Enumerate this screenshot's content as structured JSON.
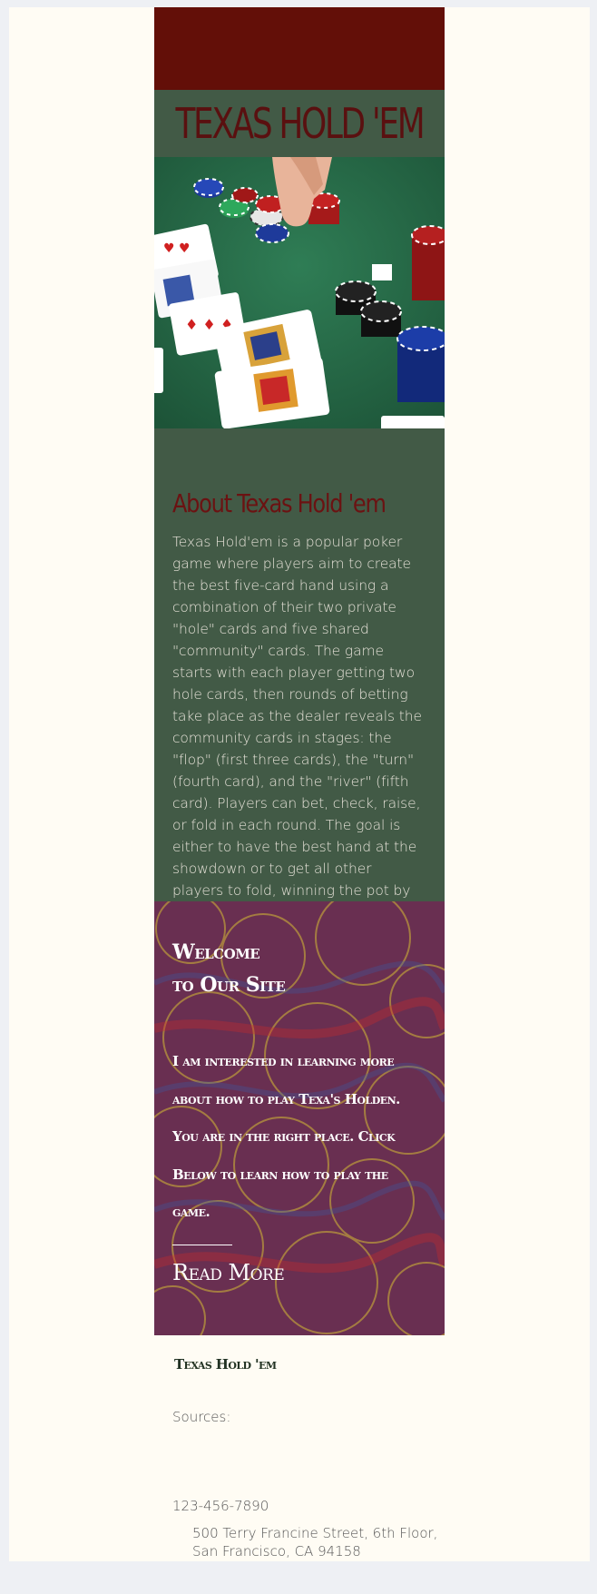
{
  "header": {
    "site_title": "Texas Hold 'em"
  },
  "hero": {
    "image_icon": "poker-table-photo"
  },
  "about": {
    "heading": "About Texas Hold 'em",
    "body": "Texas Hold'em is a popular poker game where players aim to create the best five-card hand using a combination of their two private \"hole\" cards and five shared \"community\" cards. The game starts with each player getting two hole cards, then rounds of betting take place as the dealer reveals the community cards in stages: the \"flop\" (first three cards), the \"turn\" (fourth card), and the \"river\" (fifth card). Players can bet, check, raise, or fold in each round. The goal is either to have the best hand at the showdown or to get all other players to fold, winning the pot by default."
  },
  "welcome": {
    "title_line1": "Welcome",
    "title_line2": "to Our Site",
    "text": "I am interested in learning more about how to play Texa's Holden. You are in the right place. Click Below to learn how to play the game.",
    "read_more_label": "Read More"
  },
  "footer": {
    "title": "Texas Hold 'em",
    "sources_label": "Sources:",
    "phone": "123-456-7890",
    "address_line1": "500 Terry Francine Street, 6th Floor,",
    "address_line2": "San Francisco, CA 94158"
  },
  "colors": {
    "top_band": "#630f08",
    "green_panel": "#425a46",
    "title_red": "#5a1010",
    "page_bg": "#fffcf4",
    "outer_bg": "#eef0f4"
  }
}
